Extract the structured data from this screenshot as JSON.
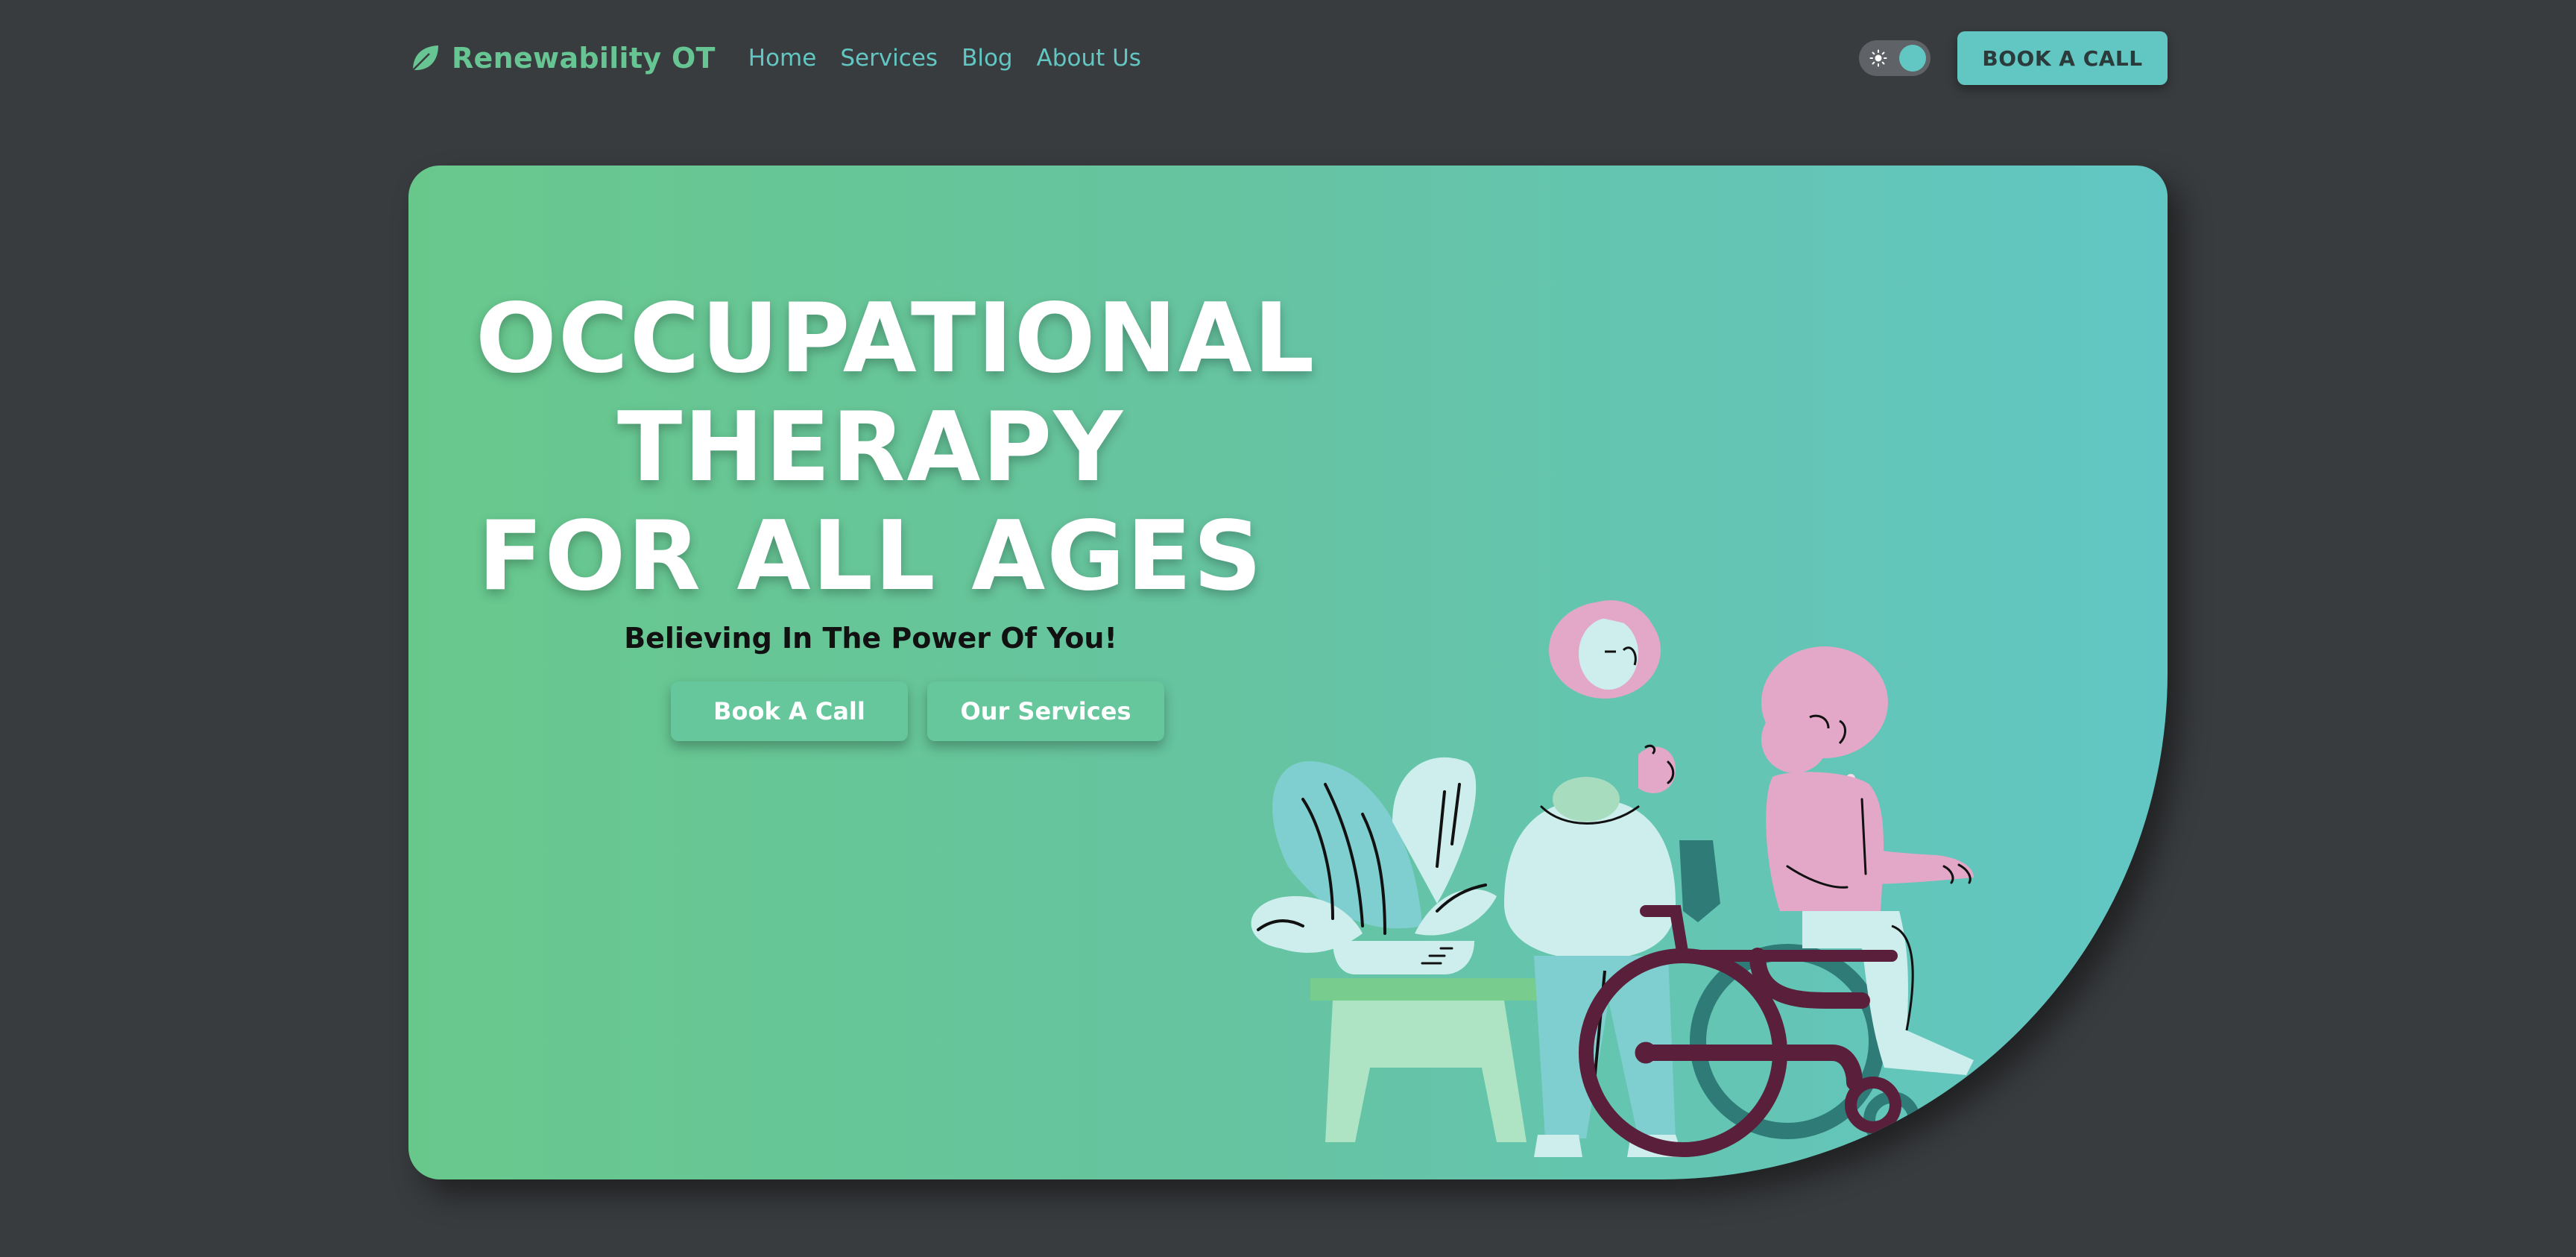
{
  "nav": {
    "brand": "Renewability OT",
    "links": [
      "Home",
      "Services",
      "Blog",
      "About Us"
    ],
    "cta_label": "BOOK A CALL",
    "logo_icon": "leaf-icon",
    "toggle_icon": "sun-icon"
  },
  "hero": {
    "title_lines": [
      "OCCUPATIONAL",
      "THERAPY",
      "FOR ALL AGES"
    ],
    "subtitle": "Believing In The Power Of You!",
    "primary_button": "Book A Call",
    "secondary_button": "Our Services",
    "illustration": "therapist-with-wheelchair-client-illustration"
  },
  "colors": {
    "page_bg": "#393c3f",
    "accent_green": "#67c493",
    "accent_teal": "#62c6c2",
    "hero_gradient_start": "#68c88c",
    "hero_gradient_end": "#62c6c4",
    "figure_pink": "#e3a8c8",
    "wheelchair": "#5a1f3a"
  }
}
